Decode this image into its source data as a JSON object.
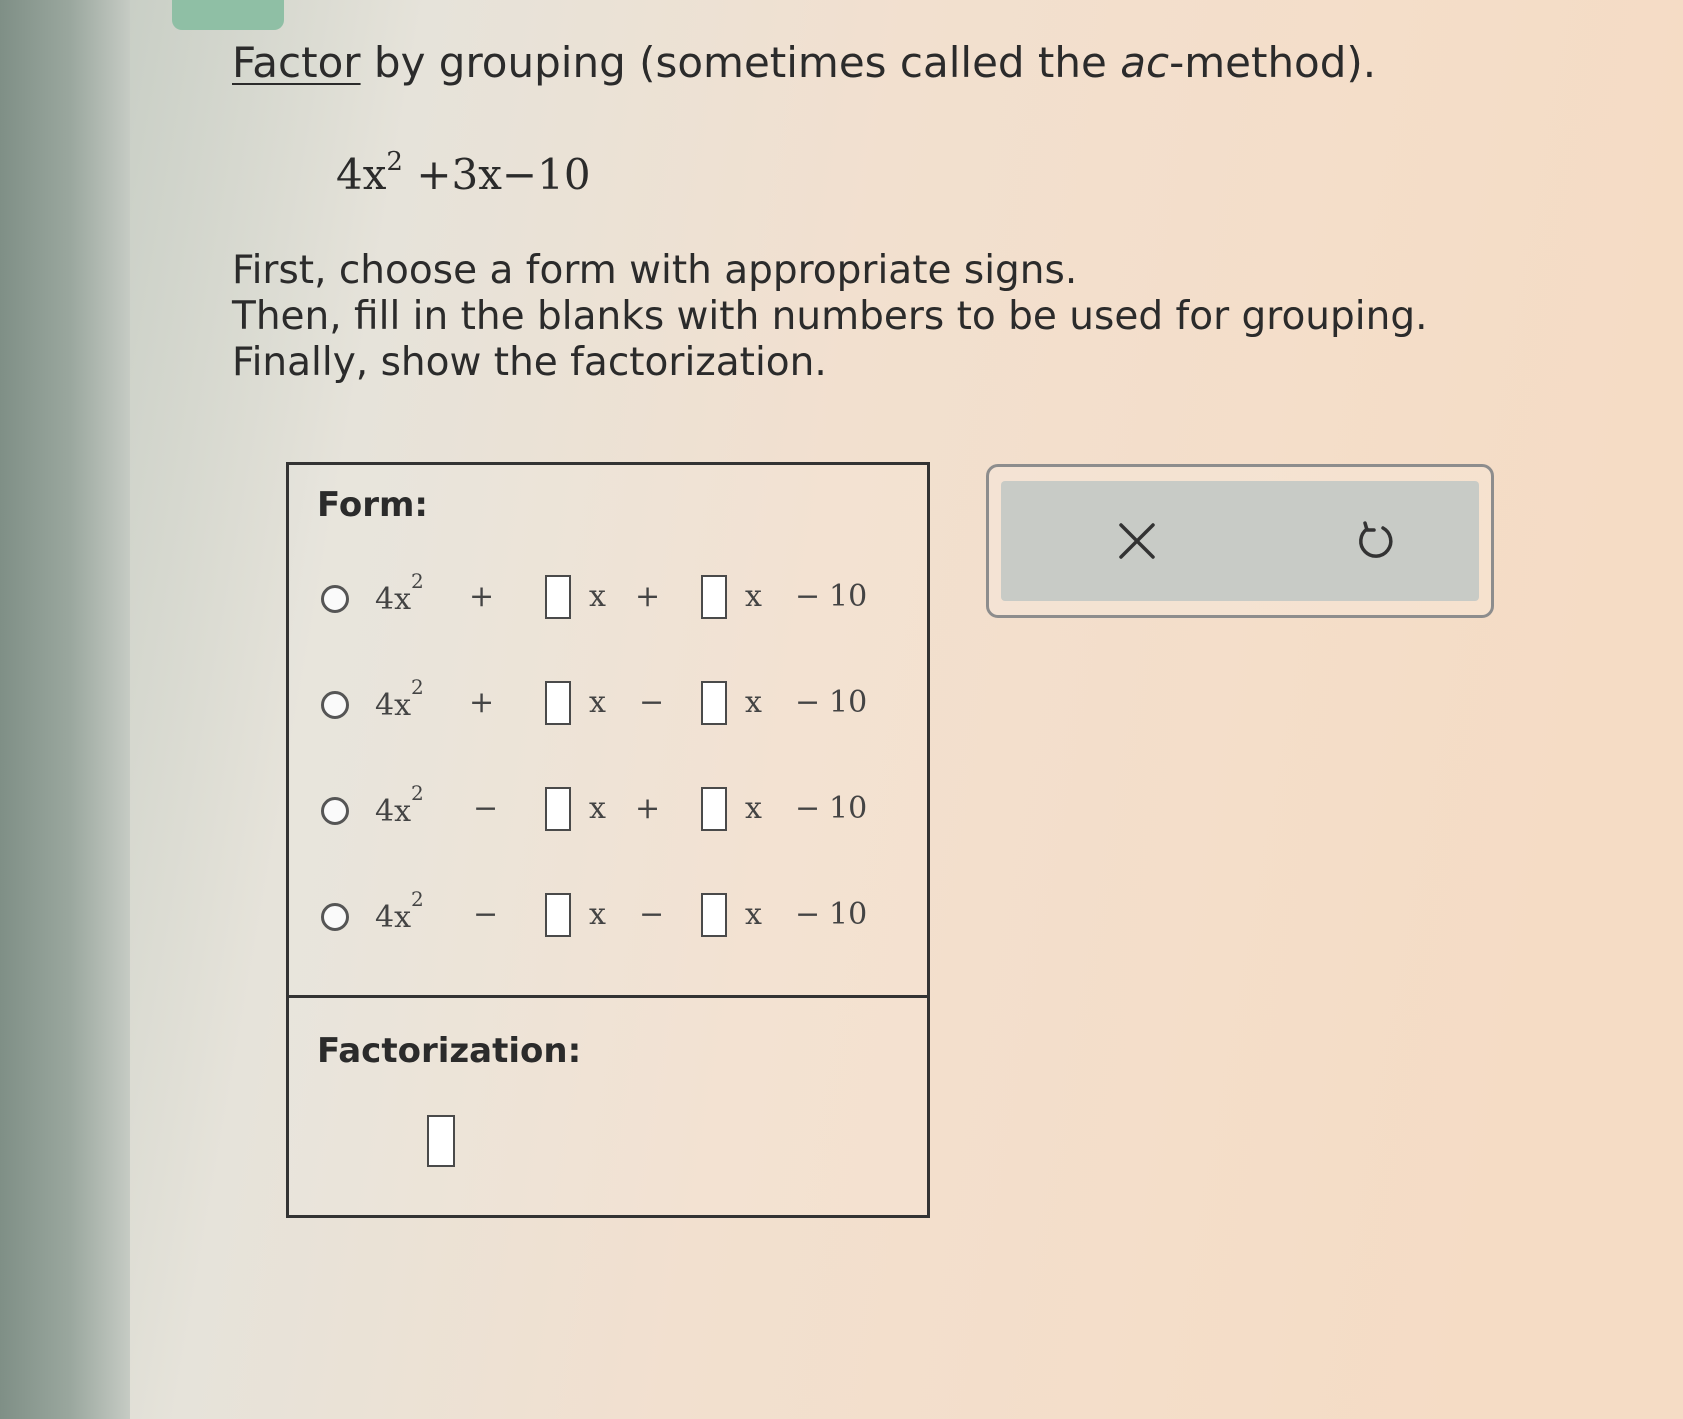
{
  "question": {
    "title_link": "Factor",
    "title_mid": " by grouping (sometimes called the ",
    "title_em": "ac",
    "title_end": "-method).",
    "poly_coef": "4x",
    "poly_exp": "2",
    "poly_rest": " +3x−10",
    "instructions": [
      "First, choose a form with appropriate signs.",
      "Then, fill in the blanks with numbers to be used for grouping.",
      "Finally, show the factorization."
    ]
  },
  "form_panel": {
    "label": "Form:",
    "options": [
      {
        "lead": "4x",
        "exp": "2",
        "s1": "+",
        "v1": "x",
        "s2": "+",
        "v2": "x",
        "s3": "−",
        "const": "10"
      },
      {
        "lead": "4x",
        "exp": "2",
        "s1": "+",
        "v1": "x",
        "s2": "−",
        "v2": "x",
        "s3": "−",
        "const": "10"
      },
      {
        "lead": "4x",
        "exp": "2",
        "s1": "−",
        "v1": "x",
        "s2": "+",
        "v2": "x",
        "s3": "−",
        "const": "10"
      },
      {
        "lead": "4x",
        "exp": "2",
        "s1": "−",
        "v1": "x",
        "s2": "−",
        "v2": "x",
        "s3": "−",
        "const": "10"
      }
    ],
    "factorization_label": "Factorization:"
  },
  "toolbar": {
    "clear_icon": "close-icon",
    "undo_icon": "undo-icon"
  },
  "colors": {
    "tab_accent": "#8fbfa5",
    "tool_bg": "#c8cbc6"
  }
}
